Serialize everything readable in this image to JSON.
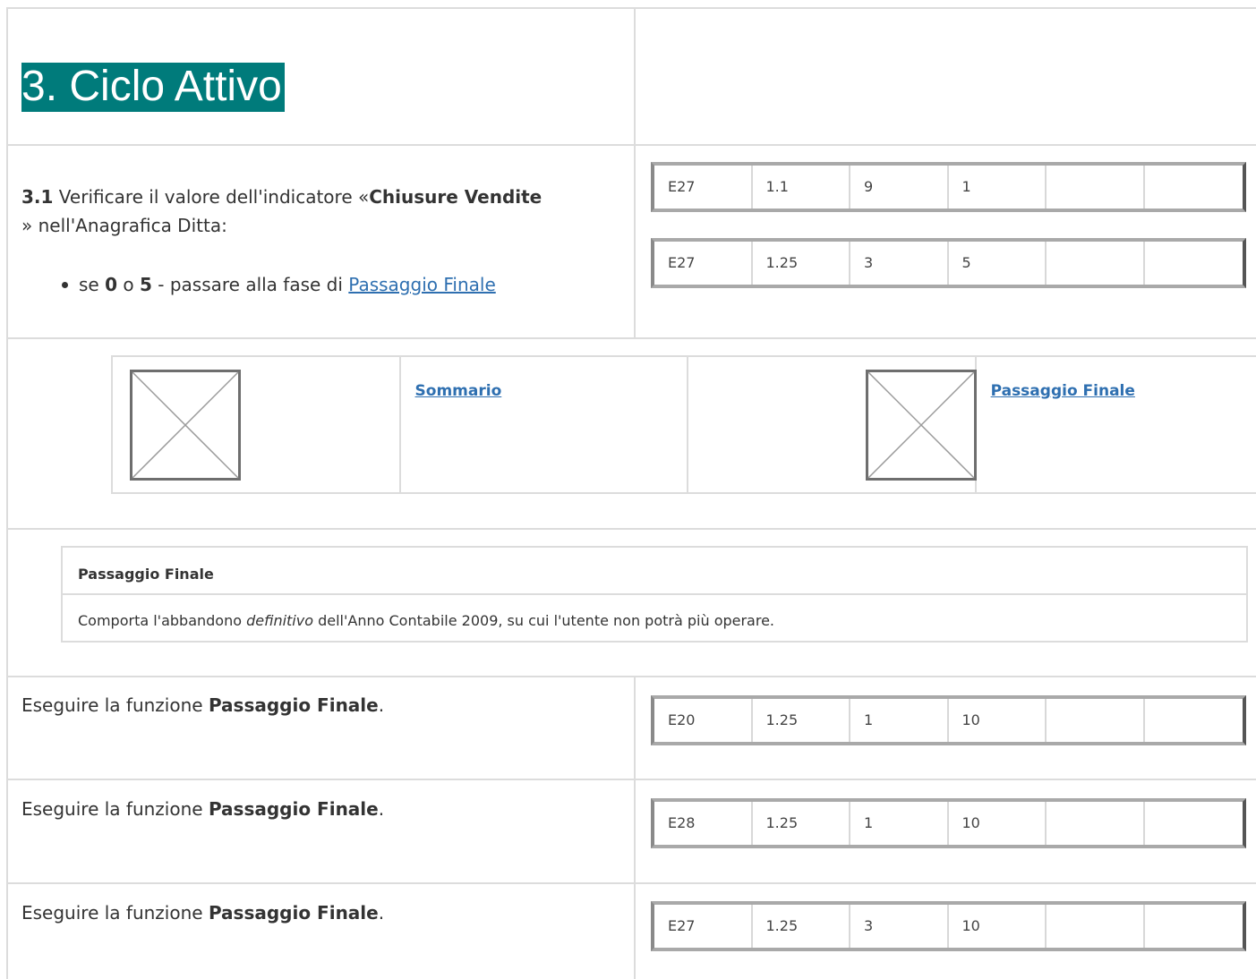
{
  "section": {
    "title": "3. Ciclo Attivo"
  },
  "step_3_1": {
    "number": "3.1",
    "text_before": " Verificare il valore dell'indicatore «",
    "indicator": "Chiusure Vendite",
    "text_after": " » nell'Anagrafica Ditta:",
    "bullet": {
      "prefix": "se ",
      "value_a": "0",
      "conj": " o ",
      "value_b": "5",
      "middle": " - passare alla fase di ",
      "link": "Passaggio Finale"
    },
    "codes": [
      [
        "E27",
        "1.1",
        "9",
        "1",
        "",
        ""
      ],
      [
        "E27",
        "1.25",
        "3",
        "5",
        "",
        ""
      ]
    ]
  },
  "nav": {
    "prev_icon": "broken-image-icon",
    "prev_label": "Sommario",
    "next_icon": "broken-image-icon",
    "next_label": "Passaggio Finale"
  },
  "note": {
    "title": "Passaggio Finale",
    "body_before": "Comporta l'abbandono ",
    "body_em": "definitivo",
    "body_after": " dell'Anno Contabile 2009, su cui l'utente non potrà più operare."
  },
  "steps": [
    {
      "text": "Eseguire la funzione ",
      "bold": "Passaggio Finale",
      "end": ".",
      "codes": [
        "E20",
        "1.25",
        "1",
        "10",
        "",
        ""
      ]
    },
    {
      "text": "Eseguire la funzione ",
      "bold": "Passaggio Finale",
      "end": ".",
      "codes": [
        "E28",
        "1.25",
        "1",
        "10",
        "",
        ""
      ]
    },
    {
      "text": "Eseguire la funzione ",
      "bold": "Passaggio Finale",
      "end": ".",
      "codes": [
        "E27",
        "1.25",
        "3",
        "10",
        "",
        ""
      ]
    }
  ]
}
